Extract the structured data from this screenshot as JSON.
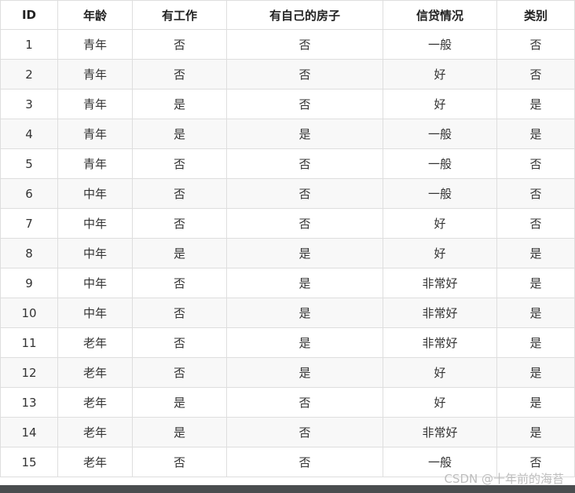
{
  "table": {
    "columns": [
      "ID",
      "年龄",
      "有工作",
      "有自己的房子",
      "信贷情况",
      "类别"
    ],
    "rows": [
      [
        "1",
        "青年",
        "否",
        "否",
        "一般",
        "否"
      ],
      [
        "2",
        "青年",
        "否",
        "否",
        "好",
        "否"
      ],
      [
        "3",
        "青年",
        "是",
        "否",
        "好",
        "是"
      ],
      [
        "4",
        "青年",
        "是",
        "是",
        "一般",
        "是"
      ],
      [
        "5",
        "青年",
        "否",
        "否",
        "一般",
        "否"
      ],
      [
        "6",
        "中年",
        "否",
        "否",
        "一般",
        "否"
      ],
      [
        "7",
        "中年",
        "否",
        "否",
        "好",
        "否"
      ],
      [
        "8",
        "中年",
        "是",
        "是",
        "好",
        "是"
      ],
      [
        "9",
        "中年",
        "否",
        "是",
        "非常好",
        "是"
      ],
      [
        "10",
        "中年",
        "否",
        "是",
        "非常好",
        "是"
      ],
      [
        "11",
        "老年",
        "否",
        "是",
        "非常好",
        "是"
      ],
      [
        "12",
        "老年",
        "否",
        "是",
        "好",
        "是"
      ],
      [
        "13",
        "老年",
        "是",
        "否",
        "好",
        "是"
      ],
      [
        "14",
        "老年",
        "是",
        "否",
        "非常好",
        "是"
      ],
      [
        "15",
        "老年",
        "否",
        "否",
        "一般",
        "否"
      ]
    ]
  },
  "watermark": "CSDN @十年前的海苔"
}
